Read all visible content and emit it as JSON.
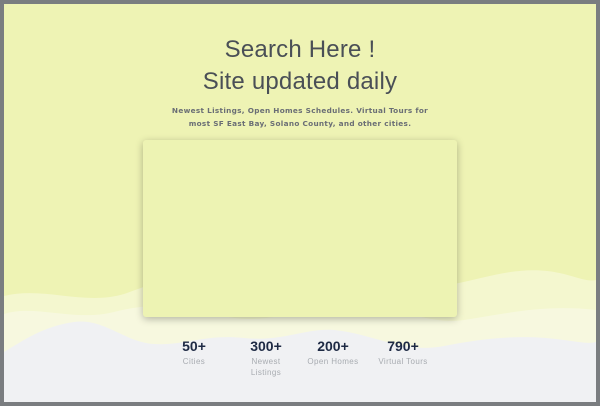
{
  "hero": {
    "heading_line1": "Search Here !",
    "heading_line2": "Site updated daily",
    "subtitle_line1": "Newest Listings, Open Homes Schedules. Virtual Tours for",
    "subtitle_line2": "most SF East Bay, Solano County, and other cities."
  },
  "stats": [
    {
      "value": "50+",
      "label_line1": "Cities",
      "label_line2": ""
    },
    {
      "value": "300+",
      "label_line1": "Newest",
      "label_line2": "Listings"
    },
    {
      "value": "200+",
      "label_line1": "Open Homes",
      "label_line2": ""
    },
    {
      "value": "790+",
      "label_line1": "Virtual Tours",
      "label_line2": ""
    }
  ],
  "colors": {
    "background": "#eef3b4",
    "wave_light": "#f4f7cf",
    "wave_white": "#f0f1f3",
    "heading": "#4a4f56",
    "stat_value": "#1e2a44",
    "stat_label": "#a8acb1",
    "frame": "#7a7d80"
  }
}
